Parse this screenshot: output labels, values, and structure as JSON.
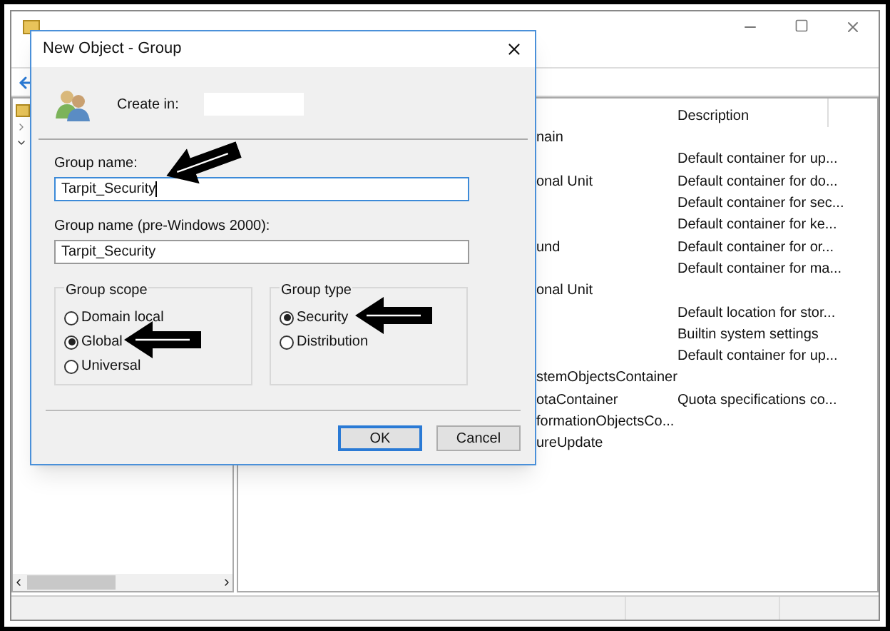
{
  "list": {
    "columns": [
      {
        "label": "Description"
      }
    ],
    "rows": [
      {
        "name": "nain"
      },
      {
        "description": "Default container for up..."
      },
      {
        "name": "onal Unit",
        "description": "Default container for do..."
      },
      {
        "description": "Default container for sec..."
      },
      {
        "description": "Default container for ke..."
      },
      {
        "name": "und",
        "description": "Default container for or..."
      },
      {
        "description": "Default container for ma..."
      },
      {
        "name": "onal Unit"
      },
      {
        "description": "Default location for stor..."
      },
      {
        "description": "Builtin system settings"
      },
      {
        "description": "Default container for up..."
      },
      {
        "name": "stemObjectsContainer"
      },
      {
        "name": "otaContainer",
        "description": "Quota specifications co..."
      },
      {
        "name": "formationObjectsCo..."
      },
      {
        "name": "ureUpdate"
      }
    ]
  },
  "dialog": {
    "title": "New Object - Group",
    "create_in_label": "Create in:",
    "fields": [
      {
        "label": "Group name:",
        "value": "Tarpit_Security",
        "focused": true
      },
      {
        "label": "Group name (pre-Windows 2000):",
        "value": "Tarpit_Security",
        "focused": false
      }
    ],
    "groups": [
      {
        "title": "Group scope",
        "options": [
          {
            "label": "Domain local",
            "selected": false
          },
          {
            "label": "Global",
            "selected": true
          },
          {
            "label": "Universal",
            "selected": false
          }
        ]
      },
      {
        "title": "Group type",
        "options": [
          {
            "label": "Security",
            "selected": true
          },
          {
            "label": "Distribution",
            "selected": false
          }
        ]
      }
    ],
    "buttons": [
      {
        "label": "OK",
        "default": true
      },
      {
        "label": "Cancel",
        "default": false
      }
    ]
  }
}
